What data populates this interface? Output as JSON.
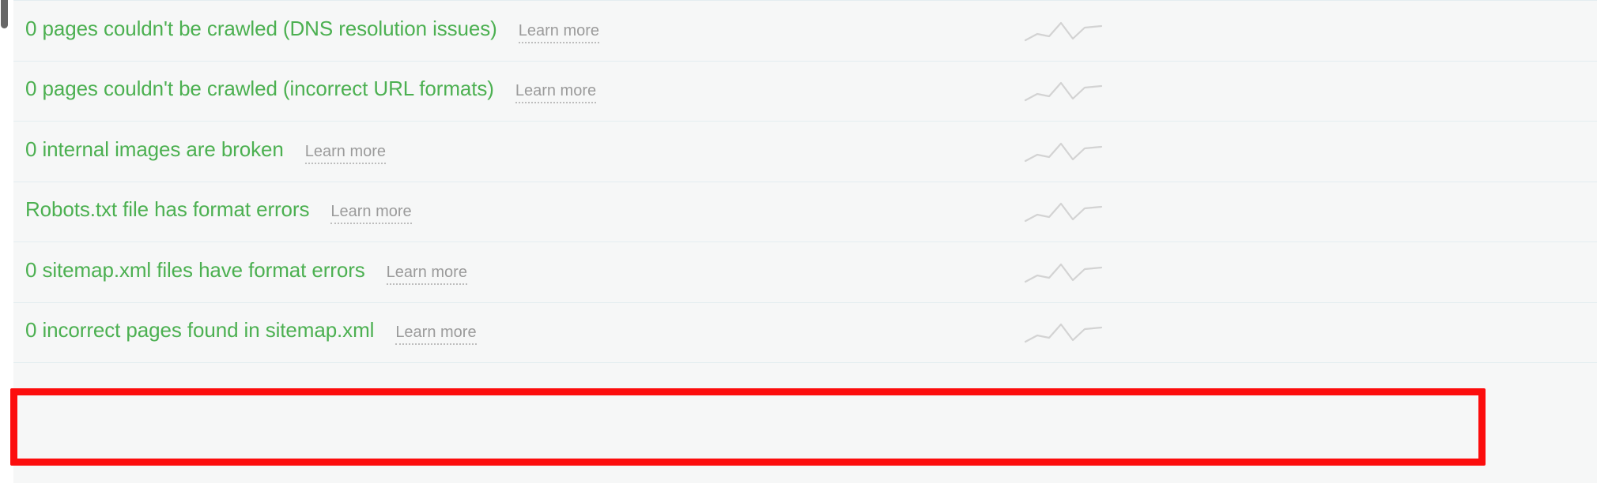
{
  "page": {
    "background_color": "#f6f7f7",
    "divider_color": "#e3edf0",
    "issue_text_color": "#4cb051",
    "learn_more_color": "#9b9b9b",
    "highlight_color": "#fc0d0d",
    "sparkline_color": "#d3d3d3"
  },
  "scrollbar": {
    "name": "vertical-scrollbar-thumb",
    "color": "#666666"
  },
  "learn_more_label": "Learn more",
  "issues": [
    {
      "label": "0 pages couldn't be crawled (DNS resolution issues)",
      "learn_more": "Learn more",
      "highlighted": false
    },
    {
      "label": "0 pages couldn't be crawled (incorrect URL formats)",
      "learn_more": "Learn more",
      "highlighted": false
    },
    {
      "label": "0 internal images are broken",
      "learn_more": "Learn more",
      "highlighted": false
    },
    {
      "label": "Robots.txt file has format errors",
      "learn_more": "Learn more",
      "highlighted": false
    },
    {
      "label": "0 sitemap.xml files have format errors",
      "learn_more": "Learn more",
      "highlighted": false
    },
    {
      "label": "0 incorrect pages found in sitemap.xml",
      "learn_more": "Learn more",
      "highlighted": true
    }
  ],
  "chart_data": {
    "type": "line",
    "title": "",
    "xlabel": "",
    "ylabel": "",
    "note": "Row trend sparklines — identical 7-point series repeated for every issue row",
    "grid": false,
    "legend": false,
    "x": [
      0,
      1,
      2,
      3,
      4,
      5,
      6
    ],
    "ylim": [
      0,
      10
    ],
    "series": [
      {
        "name": "trend",
        "values": [
          1,
          4,
          3,
          8,
          2,
          6,
          7
        ]
      }
    ]
  }
}
